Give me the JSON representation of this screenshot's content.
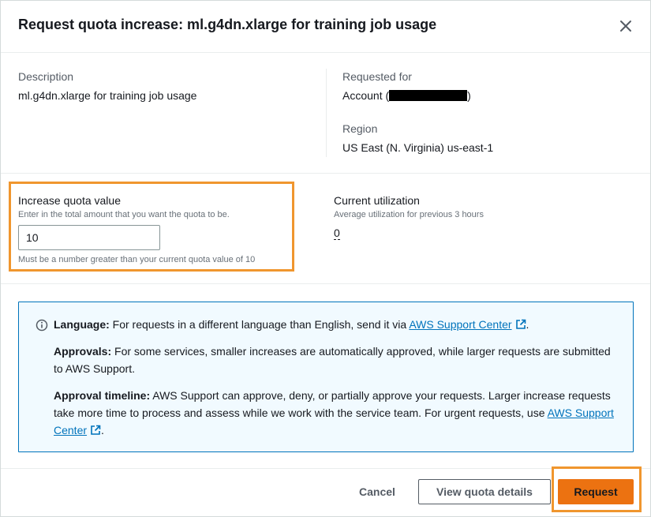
{
  "dialog": {
    "title": "Request quota increase: ml.g4dn.xlarge for training job usage"
  },
  "details": {
    "description_label": "Description",
    "description_value": "ml.g4dn.xlarge for training job usage",
    "requested_for_label": "Requested for",
    "account_prefix": "Account (",
    "account_suffix": ")",
    "region_label": "Region",
    "region_value": "US East (N. Virginia) us-east-1"
  },
  "quota": {
    "label": "Increase quota value",
    "hint": "Enter in the total amount that you want the quota to be.",
    "value": "10",
    "constraint": "Must be a number greater than your current quota value of 10"
  },
  "utilization": {
    "label": "Current utilization",
    "hint": "Average utilization for previous 3 hours",
    "value": "0"
  },
  "info": {
    "language_title": "Language:",
    "language_text": " For requests in a different language than English, send it via ",
    "language_link": "AWS Support Center",
    "language_end": ".",
    "approvals_title": "Approvals:",
    "approvals_text": " For some services, smaller increases are automatically approved, while larger requests are submitted to AWS Support.",
    "timeline_title": "Approval timeline:",
    "timeline_text": " AWS Support can approve, deny, or partially approve your requests. Larger increase requests take more time to process and assess while we work with the service team. For urgent requests, use ",
    "timeline_link": "AWS Support Center",
    "timeline_end": "."
  },
  "footer": {
    "cancel_label": "Cancel",
    "view_label": "View quota details",
    "request_label": "Request"
  },
  "colors": {
    "accent": "#ec7211",
    "highlight": "#f0962e",
    "link": "#0073bb",
    "info_bg": "#f1faff"
  },
  "icons": {
    "close": "close-icon",
    "info": "info-icon",
    "external": "external-link-icon"
  }
}
